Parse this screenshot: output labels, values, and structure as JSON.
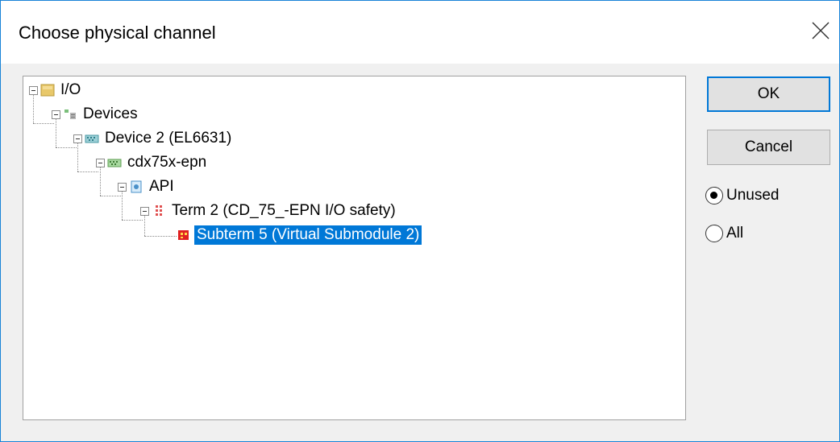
{
  "dialog": {
    "title": "Choose physical channel"
  },
  "tree": {
    "nodes": [
      {
        "label": "I/O",
        "icon": "io-folder-icon"
      },
      {
        "label": "Devices",
        "icon": "devices-icon"
      },
      {
        "label": "Device 2 (EL6631)",
        "icon": "ethernet-device-icon"
      },
      {
        "label": "cdx75x-epn",
        "icon": "network-box-icon"
      },
      {
        "label": "API",
        "icon": "api-icon"
      },
      {
        "label": "Term 2 (CD_75_-EPN I/O safety)",
        "icon": "terminal-icon"
      },
      {
        "label": "Subterm 5 (Virtual Submodule 2)",
        "icon": "subterm-icon",
        "selected": true
      }
    ]
  },
  "buttons": {
    "ok": "OK",
    "cancel": "Cancel"
  },
  "filter": {
    "unused": "Unused",
    "all": "All",
    "selected": "Unused"
  },
  "colors": {
    "selection": "#0078d7",
    "border_accent": "#1883d7"
  }
}
